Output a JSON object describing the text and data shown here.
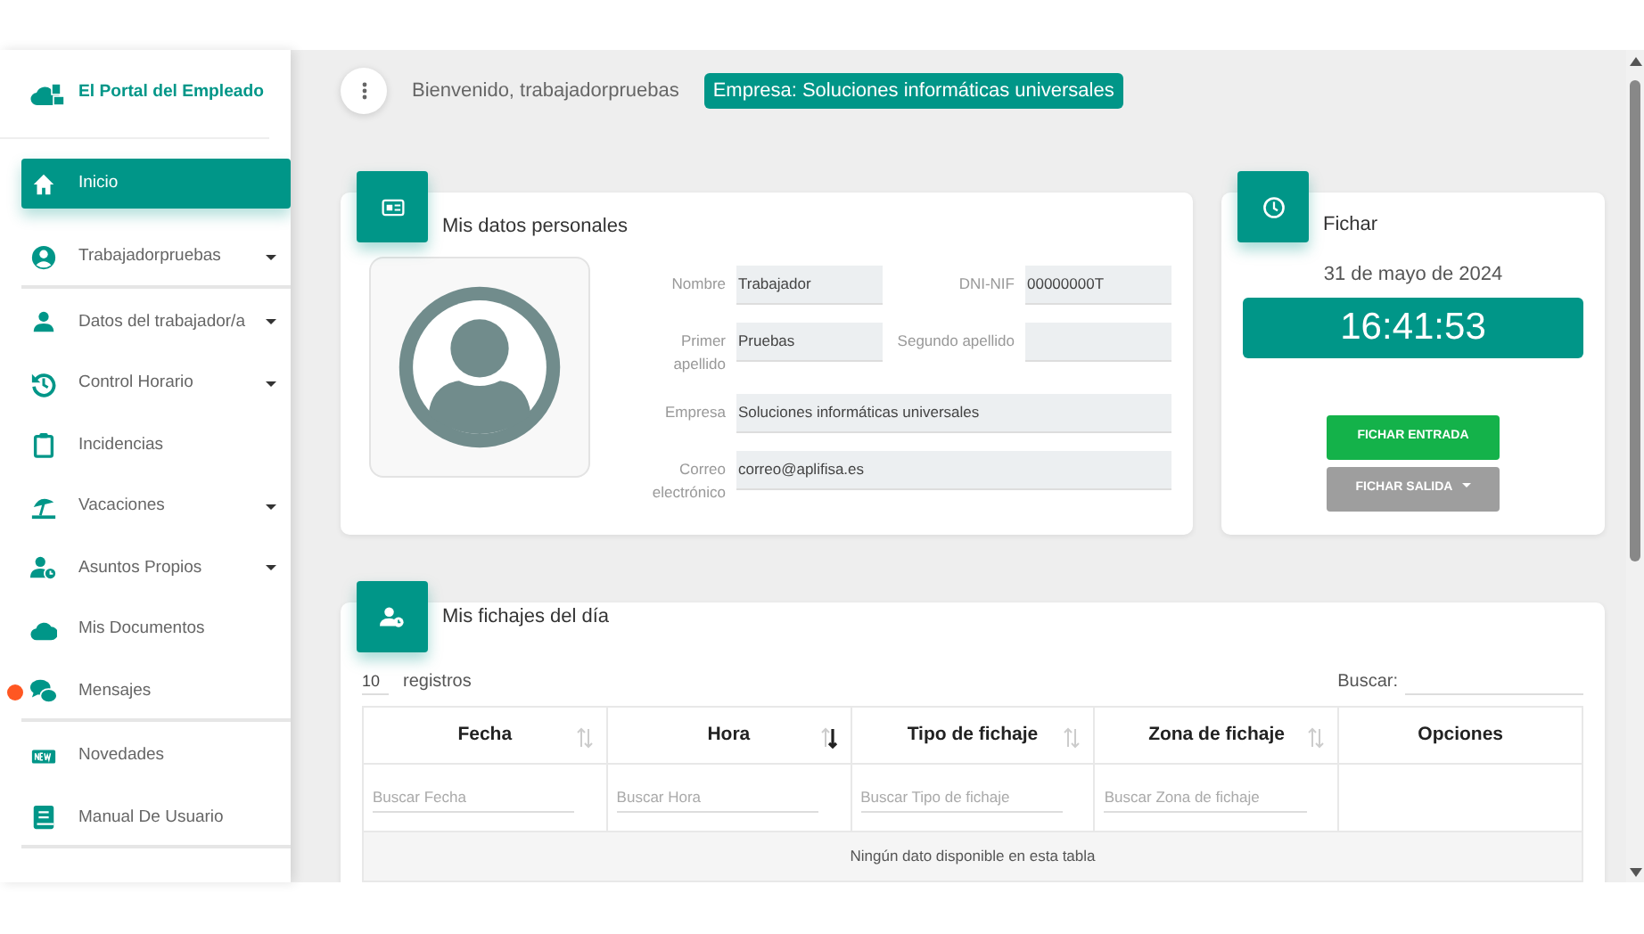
{
  "brand": {
    "title": "El Portal del Empleado"
  },
  "sidebar": {
    "items": [
      {
        "kind": "home",
        "label": "Inicio",
        "selected": true,
        "submenu": false,
        "notification": false,
        "divider_after": false
      },
      {
        "kind": "user-circle",
        "label": "Trabajadorpruebas",
        "selected": false,
        "submenu": true,
        "notification": false,
        "divider_after": true
      },
      {
        "kind": "user",
        "label": "Datos del trabajador/a",
        "selected": false,
        "submenu": true,
        "notification": false,
        "divider_after": false
      },
      {
        "kind": "history",
        "label": "Control Horario",
        "selected": false,
        "submenu": true,
        "notification": false,
        "divider_after": false
      },
      {
        "kind": "clipboard",
        "label": "Incidencias",
        "selected": false,
        "submenu": false,
        "notification": false,
        "divider_after": false
      },
      {
        "kind": "beach",
        "label": "Vacaciones",
        "selected": false,
        "submenu": true,
        "notification": false,
        "divider_after": false
      },
      {
        "kind": "user-clock",
        "label": "Asuntos Propios",
        "selected": false,
        "submenu": true,
        "notification": false,
        "divider_after": false
      },
      {
        "kind": "cloud",
        "label": "Mis Documentos",
        "selected": false,
        "submenu": false,
        "notification": false,
        "divider_after": false
      },
      {
        "kind": "chat",
        "label": "Mensajes",
        "selected": false,
        "submenu": false,
        "notification": true,
        "divider_after": true
      },
      {
        "kind": "new",
        "label": "Novedades",
        "selected": false,
        "submenu": false,
        "notification": false,
        "divider_after": false
      },
      {
        "kind": "book",
        "label": "Manual De Usuario",
        "selected": false,
        "submenu": false,
        "notification": false,
        "divider_after": true
      }
    ]
  },
  "header": {
    "welcome": "Bienvenido, trabajadorpruebas",
    "company": "Empresa: Soluciones informáticas universales"
  },
  "personal": {
    "title": "Mis datos personales",
    "fields": [
      {
        "label": "Nombre",
        "value": "Trabajador",
        "wide": false
      },
      {
        "label": "DNI-NIF",
        "value": "00000000T",
        "wide": false
      },
      {
        "label": "Primer apellido",
        "value": "Pruebas",
        "wide": false
      },
      {
        "label": "Segundo apellido",
        "wide": false
      },
      {
        "label": "Empresa",
        "value": "Soluciones informáticas universales",
        "wide": true
      },
      {
        "label": "Correo electrónico",
        "value": "correo@aplifisa.es",
        "wide": true
      }
    ]
  },
  "clock": {
    "title": "Fichar",
    "date": "31 de mayo de 2024",
    "time": "16:41:53",
    "buttons": [
      {
        "label": "FICHAR ENTRADA",
        "kind": "enter",
        "dropdown": false
      },
      {
        "label": "FICHAR SALIDA",
        "kind": "exit",
        "dropdown": true
      }
    ]
  },
  "table": {
    "title": "Mis fichajes del día",
    "page_size": "10",
    "page_size_label": "registros",
    "search_label": "Buscar:",
    "columns": [
      {
        "label": "Fecha",
        "sortable": true,
        "sorted": false,
        "placeholder": "Buscar Fecha"
      },
      {
        "label": "Hora",
        "sortable": true,
        "sorted": true,
        "placeholder": "Buscar Hora"
      },
      {
        "label": "Tipo de fichaje",
        "sortable": true,
        "sorted": false,
        "placeholder": "Buscar Tipo de fichaje"
      },
      {
        "label": "Zona de fichaje",
        "sortable": true,
        "sorted": false,
        "placeholder": "Buscar Zona de fichaje"
      },
      {
        "label": "Opciones",
        "sortable": false
      }
    ],
    "empty_message": "Ningún dato disponible en esta tabla"
  }
}
